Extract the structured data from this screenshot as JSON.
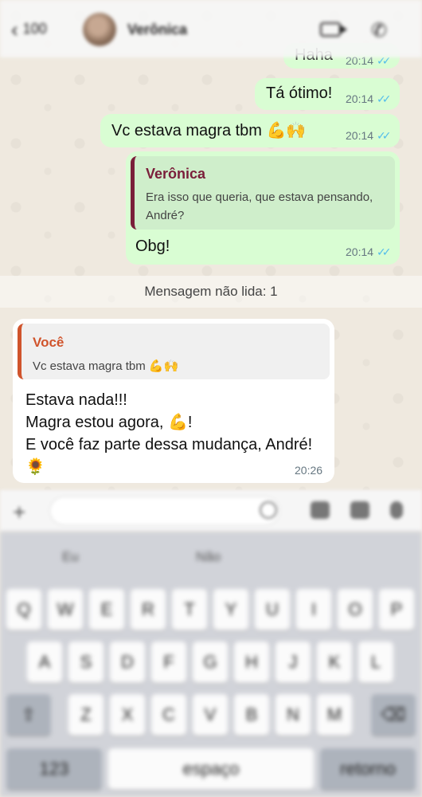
{
  "header": {
    "back_count": "100",
    "contact_name": "Verônica"
  },
  "messages": [
    {
      "text": "Haha",
      "time": "20:14"
    },
    {
      "text": "Tá ótimo!",
      "time": "20:14"
    },
    {
      "text": "Vc estava magra tbm 💪🙌",
      "time": "20:14"
    },
    {
      "quote_name": "Verônica",
      "quote_text": "Era isso que queria, que estava pensando, André?",
      "text": "Obg!",
      "time": "20:14"
    }
  ],
  "unread_label": "Mensagem não lida: 1",
  "incoming": {
    "quote_name": "Você",
    "quote_text": "Vc estava magra tbm 💪🙌",
    "text": "Estava nada!!!\nMagra estou agora, 💪!\nE você faz parte dessa mudança, André!\n🌻",
    "time": "20:26"
  },
  "keyboard": {
    "suggestions": [
      "Eu",
      "Não",
      ""
    ],
    "row1": [
      "Q",
      "W",
      "E",
      "R",
      "T",
      "Y",
      "U",
      "I",
      "O",
      "P"
    ],
    "row2": [
      "A",
      "S",
      "D",
      "F",
      "G",
      "H",
      "J",
      "K",
      "L"
    ],
    "row3": [
      "Z",
      "X",
      "C",
      "V",
      "B",
      "N",
      "M"
    ],
    "bottom": {
      "numbers": "123",
      "space": "espaço",
      "return": "retorno"
    }
  },
  "colors": {
    "outgoing_bubble": "#d9fdd3",
    "incoming_bubble": "#ffffff",
    "read_ticks": "#53bdeb",
    "quote_veronica": "#7a1e3a",
    "quote_voce": "#d0542c"
  }
}
